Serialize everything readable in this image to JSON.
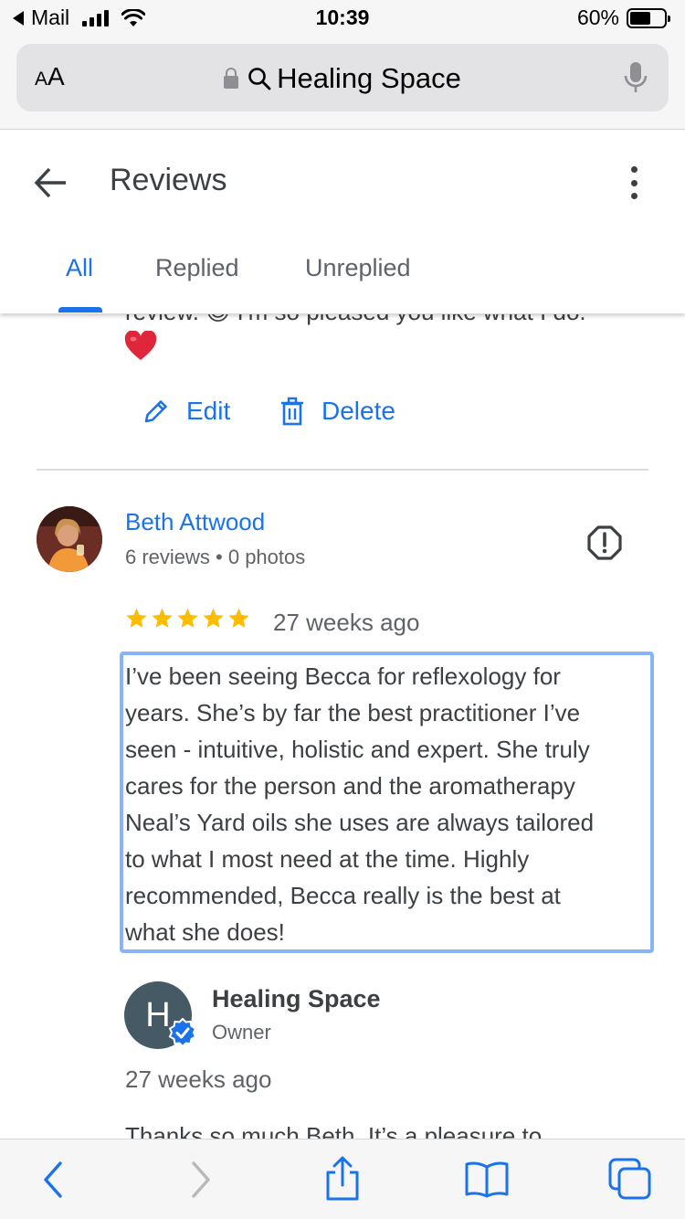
{
  "status_bar": {
    "back_app": "Mail",
    "time": "10:39",
    "battery_percent": "60%",
    "battery_level": 0.6
  },
  "browser": {
    "text_size_button": "AA",
    "address_text": "Healing Space"
  },
  "header": {
    "title": "Reviews",
    "tabs": [
      {
        "label": "All",
        "active": true
      },
      {
        "label": "Replied",
        "active": false
      },
      {
        "label": "Unreplied",
        "active": false
      }
    ]
  },
  "previous_reply": {
    "partial_text": "review. 😊 I'm so pleased you like what I do.",
    "emoji": "❤️",
    "edit_label": "Edit",
    "delete_label": "Delete"
  },
  "review": {
    "reviewer_name": "Beth Attwood",
    "reviewer_meta": "6 reviews • 0 photos",
    "rating": 5,
    "time": "27 weeks ago",
    "text": "I’ve been seeing Becca for reflexology for years. She’s by far the best practitioner I’ve seen - intuitive, holistic and expert. She truly cares for the person and the aromatherapy Neal’s Yard oils she uses are always tailored to what I most need at the time. Highly recommended, Becca really is the best at what she does!",
    "review_lines": [
      "I’ve been seeing Becca for reflexology for",
      "years. She’s by far the best practitioner I’ve",
      "seen - intuitive, holistic and expert. She truly",
      "cares for the person and the aromatherapy",
      "Neal’s Yard oils she uses are always tailored",
      "to what I most need at the time. Highly",
      "recommended, Becca really is the best at",
      "what she does!"
    ]
  },
  "owner_reply": {
    "avatar_letter": "H",
    "name": "Healing Space",
    "role": "Owner",
    "time": "27 weeks ago",
    "partial_text": "Thanks so much Beth. It’s a pleasure to"
  },
  "colors": {
    "accent_blue": "#1a73e8",
    "star_yellow": "#fbbc04",
    "highlight_border": "#8ab4f8",
    "owner_avatar": "#455a64"
  }
}
